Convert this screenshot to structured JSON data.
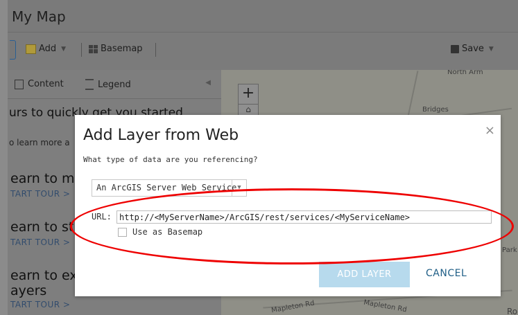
{
  "app": {
    "title": "My Map"
  },
  "toolbar": {
    "add_label": "Add",
    "basemap_label": "Basemap",
    "save_label": "Save"
  },
  "panel": {
    "tabs": [
      {
        "label": "Content",
        "icon": "content-icon"
      },
      {
        "label": "Legend",
        "icon": "legend-icon"
      }
    ],
    "intro": "urs to quickly get you started",
    "learn_more": "o learn more a",
    "tours": [
      {
        "title": "earn to m",
        "link": "TART TOUR >"
      },
      {
        "title": "earn to st",
        "link": "TART TOUR >"
      },
      {
        "title": "earn to ex",
        "title2": "ayers",
        "link": "TART TOUR >"
      }
    ]
  },
  "map": {
    "labels": [
      {
        "text": "North Arm"
      },
      {
        "text": "Bridges"
      },
      {
        "text": "Mapleton Rd"
      },
      {
        "text": "Mapleton Rd"
      },
      {
        "text": "Park"
      },
      {
        "text": "Ro"
      }
    ]
  },
  "modal": {
    "title": "Add Layer from Web",
    "close": "×",
    "question": "What type of data are you referencing?",
    "select_value": "An ArcGIS Server Web Service",
    "url_label": "URL:",
    "url_value": "http://<MyServerName>/ArcGIS/rest/services/<MyServiceName>",
    "basemap_checkbox_label": "Use as Basemap",
    "add_layer_button": "ADD LAYER",
    "cancel_button": "CANCEL"
  },
  "colors": {
    "highlight": "#e00000",
    "primary_disabled": "#b7daed",
    "link": "#1f5e86"
  }
}
